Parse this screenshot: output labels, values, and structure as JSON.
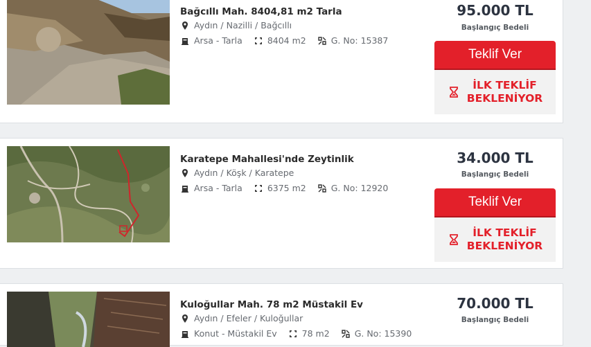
{
  "listings": [
    {
      "title": "Bağcıllı Mah. 8404,81 m2 Tarla",
      "location": "Aydın / Nazilli / Bağcıllı",
      "category": "Arsa - Tarla",
      "area": "8404 m2",
      "gno": "G. No: 15387",
      "price": "95.000 TL",
      "price_label": "Başlangıç Bedeli",
      "offer_label": "Teklif Ver",
      "status_line1": "İLK TEKLİF",
      "status_line2": "BEKLENİYOR"
    },
    {
      "title": "Karatepe Mahallesi'nde Zeytinlik",
      "location": "Aydın / Köşk / Karatepe",
      "category": "Arsa - Tarla",
      "area": "6375 m2",
      "gno": "G. No: 12920",
      "price": "34.000 TL",
      "price_label": "Başlangıç Bedeli",
      "offer_label": "Teklif Ver",
      "status_line1": "İLK TEKLİF",
      "status_line2": "BEKLENİYOR"
    },
    {
      "title": "Kuloğullar Mah. 78 m2 Müstakil Ev",
      "location": "Aydın / Efeler / Kuloğullar",
      "category": "Konut - Müstakil Ev",
      "area": "78 m2",
      "gno": "G. No: 15390",
      "price": "70.000 TL",
      "price_label": "Başlangıç Bedeli"
    }
  ],
  "icons": {
    "location": "map-pin-icon",
    "category": "building-icon",
    "area": "area-expand-icon",
    "gno": "parcel-icon",
    "status": "hourglass-icon"
  },
  "colors": {
    "accent": "#e3202a",
    "price": "#2c3340"
  }
}
